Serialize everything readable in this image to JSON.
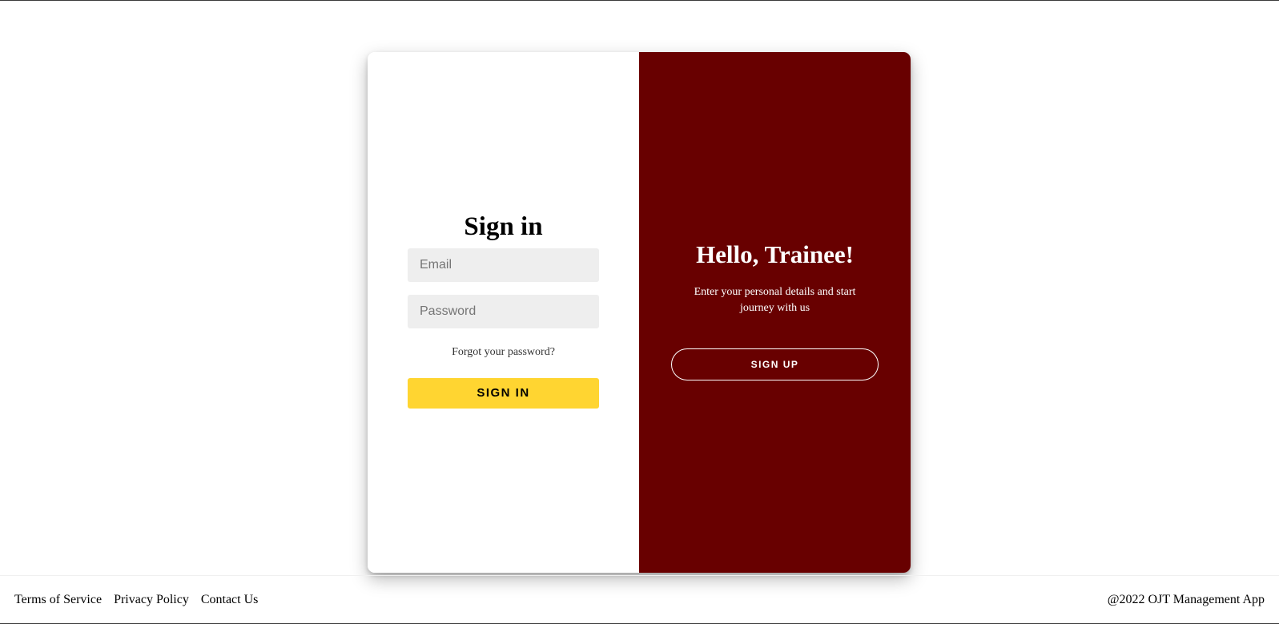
{
  "signin": {
    "title": "Sign in",
    "email_placeholder": "Email",
    "password_placeholder": "Password",
    "forgot_label": "Forgot your password?",
    "button_label": "SIGN IN"
  },
  "welcome": {
    "title": "Hello, Trainee!",
    "text": "Enter your personal details and start journey with us",
    "button_label": "SIGN UP"
  },
  "footer": {
    "links": [
      "Terms of Service",
      "Privacy Policy",
      "Contact Us"
    ],
    "copyright": "@2022 OJT Management App"
  },
  "colors": {
    "accent_dark_red": "#680000",
    "button_yellow": "#ffd531",
    "input_gray": "#eeeeee"
  }
}
